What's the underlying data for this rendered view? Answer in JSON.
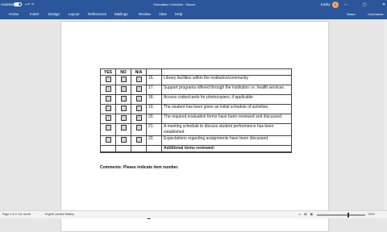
{
  "titlebar": {
    "autosave": "AutoSave",
    "doc_title": "Orientation Checklist - Saved",
    "user": "Kathy",
    "avatar": "K",
    "win_controls": "─ ▢ ✕",
    "qat_icons": [
      "save-icon",
      "undo-icon",
      "redo-icon"
    ]
  },
  "ribbon": {
    "tabs": [
      "Home",
      "Insert",
      "Design",
      "Layout",
      "References",
      "Mailings",
      "Review",
      "View",
      "Help"
    ],
    "share": "Share",
    "comments": "Comments"
  },
  "checklist": {
    "headers": [
      "YES",
      "NO",
      "N/A"
    ],
    "rows": [
      {
        "num": "16.",
        "text": "Library facilities within the institution/community"
      },
      {
        "num": "17.",
        "text": "Support programs offered through the institution i.e. health services."
      },
      {
        "num": "18.",
        "text": "Access codes/cards for photocopiers, if applicable"
      },
      {
        "num": "19.",
        "text": "The student has been given an initial schedule of activities."
      },
      {
        "num": "20.",
        "text": "The required evaluation forms have been reviewed and discussed."
      },
      {
        "num": "21.",
        "text": "A meeting schedule to discuss student performance has been established."
      },
      {
        "num": "22.",
        "text": "Expectations regarding assignments have been discussed."
      }
    ],
    "additional": "Additional items reviewed:"
  },
  "comments_label": "Comments: Please indicate item number.",
  "statusbar": {
    "page": "Page 2 of 2",
    "words": "141 words",
    "language": "English (United States)",
    "zoom": "100%"
  }
}
